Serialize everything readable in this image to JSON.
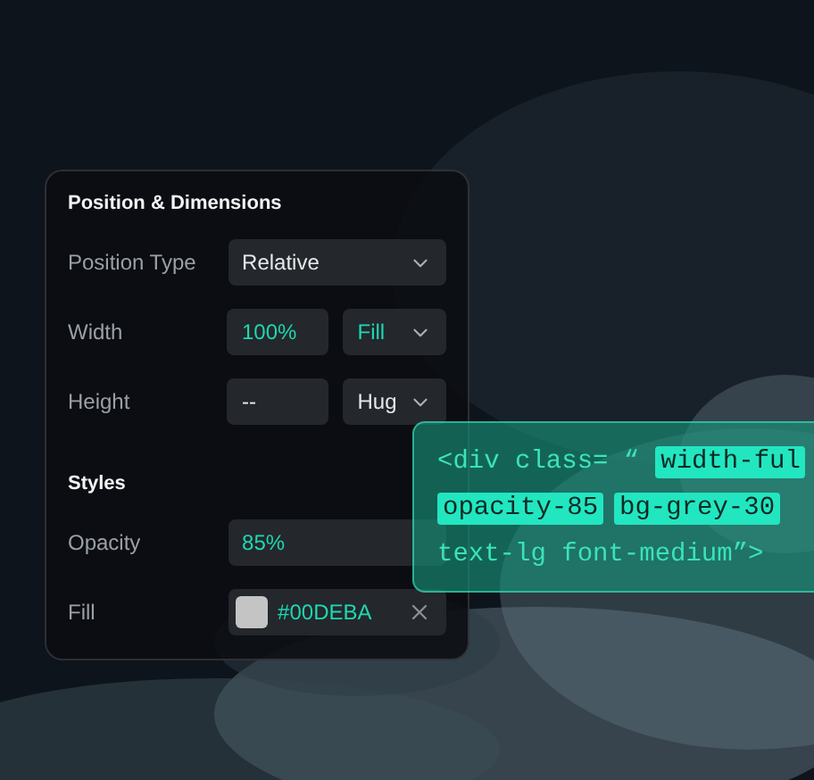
{
  "panel": {
    "title": "Position & Dimensions",
    "rows": [
      {
        "kind": "select",
        "label": "Position Type",
        "value": "Relative",
        "accent": false
      },
      {
        "kind": "pair",
        "label": "Width",
        "value": "100%",
        "option": "Fill",
        "accent": true
      },
      {
        "kind": "pair",
        "label": "Height",
        "value": "--",
        "option": "Hug",
        "accent": false
      }
    ],
    "styles_title": "Styles",
    "style_rows": [
      {
        "kind": "input",
        "label": "Opacity",
        "value": "85%"
      },
      {
        "kind": "color",
        "label": "Fill",
        "value": "#00DEBA"
      }
    ]
  },
  "code": {
    "lines": [
      [
        {
          "text": "<div class= “",
          "highlighted": false
        },
        {
          "text": "width-ful",
          "highlighted": true
        }
      ],
      [
        {
          "text": "opacity-85",
          "highlighted": true
        },
        {
          "text": "bg-grey-30",
          "highlighted": true
        }
      ],
      [
        {
          "text": "text-lg font-medium”>",
          "highlighted": false
        }
      ]
    ]
  }
}
